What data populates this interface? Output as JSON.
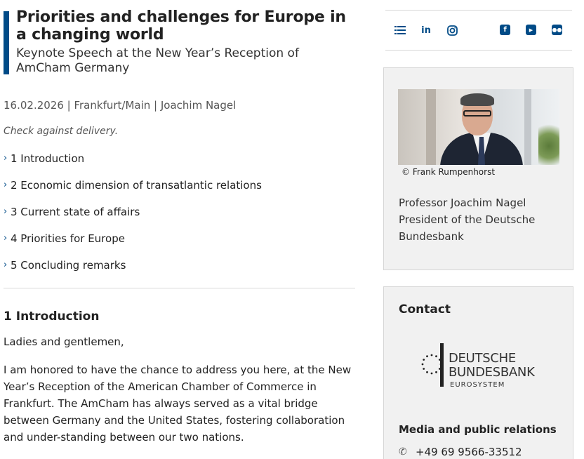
{
  "article": {
    "title": "Priorities and challenges for Europe in a changing world",
    "subtitle": "Keynote Speech at the New Year’s Reception of AmCham Germany",
    "meta": "16.02.2026 | Frankfurt/Main | Joachim Nagel",
    "note": "Check against delivery.",
    "toc": [
      "1 Introduction",
      "2 Economic dimension of transatlantic relations",
      "3 Current state of affairs",
      "4 Priorities for Europe",
      "5 Concluding remarks"
    ],
    "section_title": "1 Introduction",
    "paragraphs": [
      "Ladies and gentlemen,",
      "I am honored to have the chance to address you here, at the New Year’s Reception of the American Chamber of Commerce in Frankfurt. The AmCham has always served as a vital bridge between Germany and the United States, fostering collaboration and under-standing between our two nations."
    ]
  },
  "social": {
    "icons": [
      "list-icon",
      "linkedin-icon",
      "instagram-icon",
      "facebook-icon",
      "youtube-icon",
      "flickr-icon"
    ],
    "accent": "#004b87"
  },
  "speaker": {
    "credit": "© Frank Rumpenhorst",
    "name_line": "Professor Joachim Nagel President of the Deutsche Bundesbank"
  },
  "contact": {
    "title": "Contact",
    "logo": {
      "line1": "DEUTSCHE",
      "line2": "BUNDESBANK",
      "line3": "EUROSYSTEM"
    },
    "media_title": "Media and public relations",
    "phone": "+49 69 9566-33512"
  }
}
